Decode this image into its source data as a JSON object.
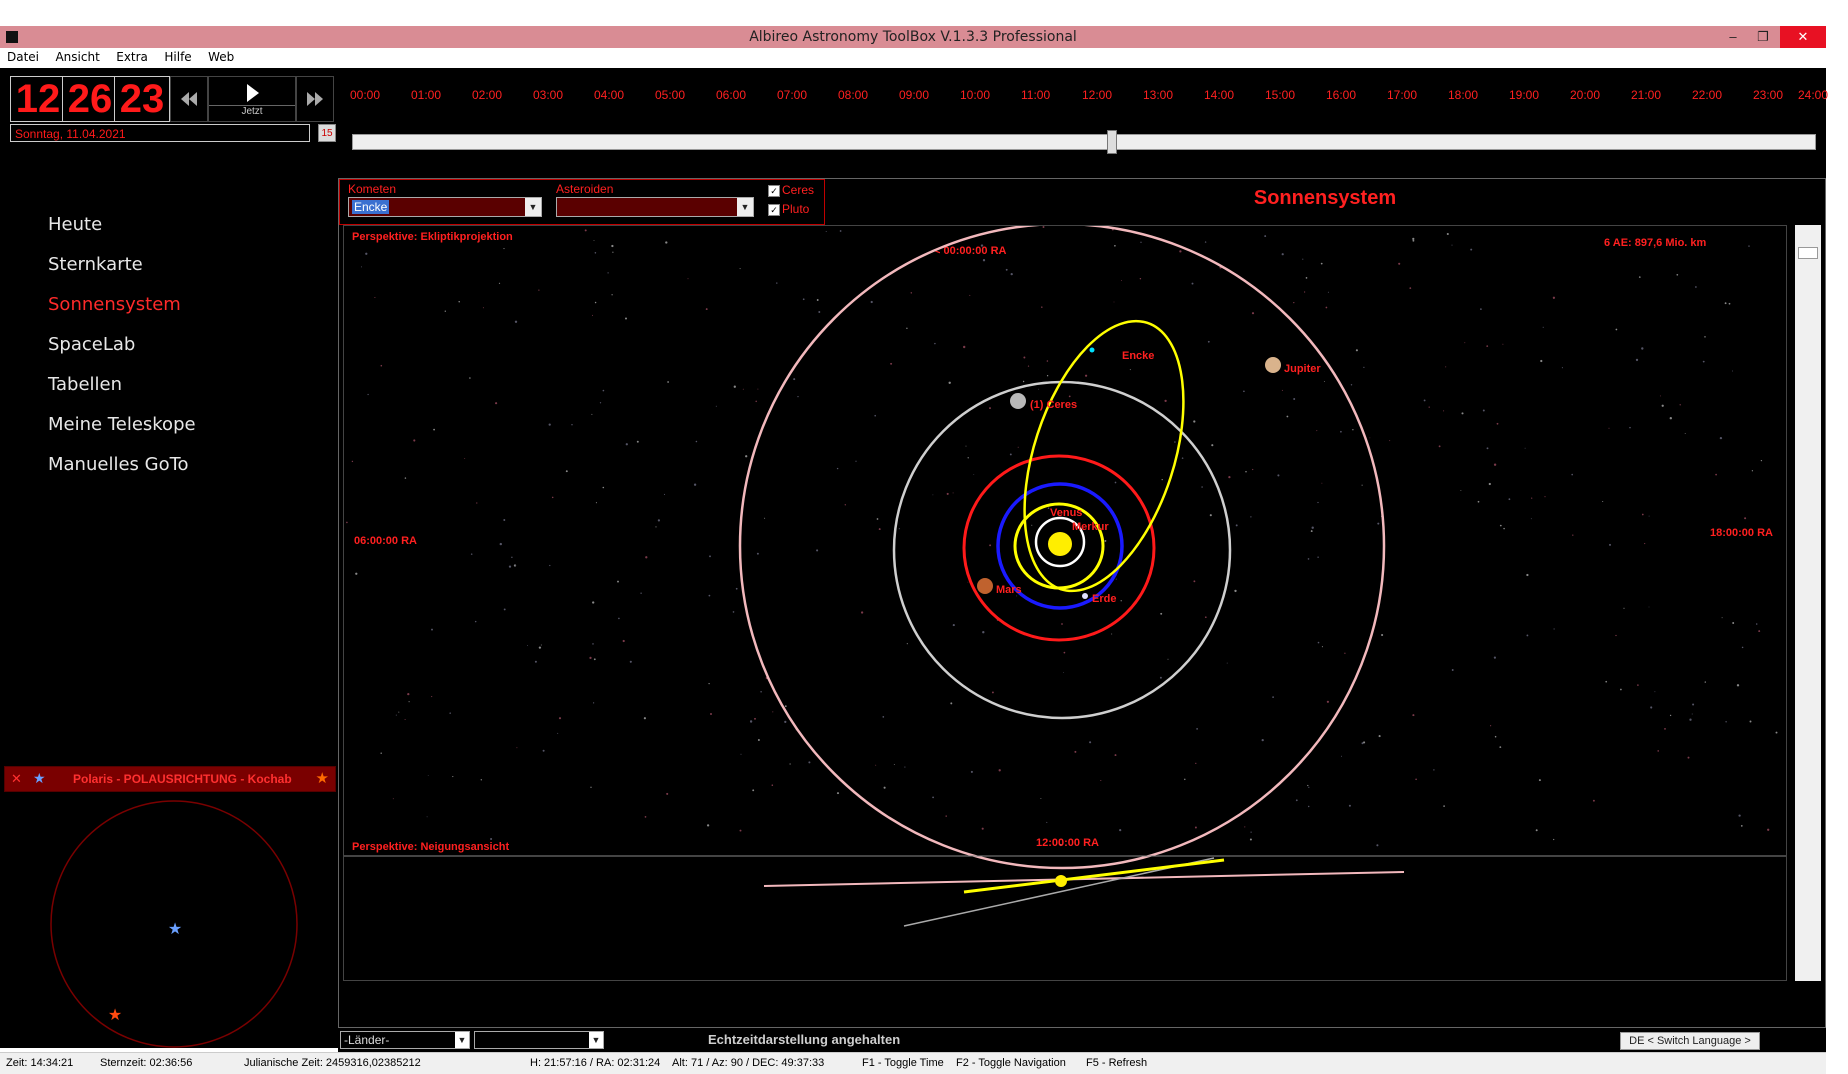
{
  "window": {
    "title": "Albireo Astronomy ToolBox V.1.3.3 Professional",
    "min": "–",
    "max": "❐",
    "close": "✕"
  },
  "menu": [
    "Datei",
    "Ansicht",
    "Extra",
    "Hilfe",
    "Web"
  ],
  "clock": {
    "hours": "12",
    "minutes": "26",
    "seconds": "23",
    "date": "Sonntag, 11.04.2021",
    "now_label": "Jetzt",
    "calendar_day": "15"
  },
  "timeline": {
    "hours": [
      "00:00",
      "01:00",
      "02:00",
      "03:00",
      "04:00",
      "05:00",
      "06:00",
      "07:00",
      "08:00",
      "09:00",
      "10:00",
      "11:00",
      "12:00",
      "13:00",
      "14:00",
      "15:00",
      "16:00",
      "17:00",
      "18:00",
      "19:00",
      "20:00",
      "21:00",
      "22:00",
      "23:00",
      "24:00"
    ],
    "position": 0.519
  },
  "nav": [
    {
      "label": "Heute",
      "active": false
    },
    {
      "label": "Sternkarte",
      "active": false
    },
    {
      "label": "Sonnensystem",
      "active": true
    },
    {
      "label": "SpaceLab",
      "active": false
    },
    {
      "label": "Tabellen",
      "active": false
    },
    {
      "label": "Meine Teleskope",
      "active": false
    },
    {
      "label": "Manuelles GoTo",
      "active": false
    }
  ],
  "polar": {
    "close": "✕",
    "text": "Polaris - POLAUSRICHTUNG - Kochab"
  },
  "filters": {
    "comets_label": "Kometen",
    "comets_value": "Encke",
    "asteroids_label": "Asteroiden",
    "asteroids_value": "",
    "ceres_label": "Ceres",
    "ceres_checked": true,
    "pluto_label": "Pluto",
    "pluto_checked": true
  },
  "panel_title": "Sonnensystem",
  "sky": {
    "perspective": "Perspektive: Ekliptikprojektion",
    "scale": "6 AE: 897,6 Mio. km",
    "ra_top": "< 00:00:00 RA",
    "ra_left": "06:00:00 RA",
    "ra_right": "18:00:00 RA",
    "ra_bottom": "12:00:00 RA",
    "tilt_perspective": "Perspektive: Neigungsansicht",
    "labels": {
      "encke": "Encke",
      "jupiter": "Jupiter",
      "ceres": "(1) Ceres",
      "venus": "Venus",
      "merkur": "Merkur",
      "mars": "Mars",
      "erde": "Erde"
    },
    "colors": {
      "jupiter_orbit": "#f2b8bc",
      "ceres_orbit": "#cfcfcf",
      "mars_orbit": "#ff1a1a",
      "earth_orbit": "#1a1aff",
      "venus_orbit": "#ffff00",
      "mercury_orbit": "#ffffff",
      "comet_orbit": "#ffff00",
      "sun": "#ffee00",
      "label": "#ff2020"
    }
  },
  "bottom": {
    "country_placeholder": "-Länder-",
    "city_value": "",
    "realtime_status": "Echtzeitdarstellung angehalten",
    "language_button": "DE < Switch Language > EN"
  },
  "status": {
    "time": "Zeit: 14:34:21",
    "sidereal": "Sternzeit: 02:36:56",
    "julian": "Julianische Zeit: 2459316,02385212",
    "hra": "H: 21:57:16 / RA: 02:31:24",
    "altaz": "Alt: 71 / Az: 90 / DEC: 49:37:33",
    "f1": "F1 - Toggle Time",
    "f2": "F2 - Toggle Navigation",
    "f5": "F5 - Refresh"
  }
}
